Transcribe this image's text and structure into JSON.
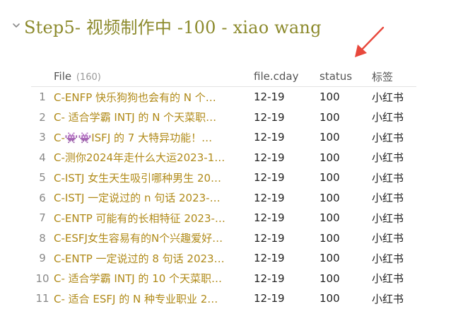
{
  "heading": {
    "title": "Step5- 视频制作中 -100 - xiao wang"
  },
  "table": {
    "columns": {
      "file": "File",
      "file_count": "(160)",
      "day": "file.cday",
      "status": "status",
      "tag": "标签"
    },
    "rows": [
      {
        "num": "1",
        "file": "C-ENFP 快乐狗狗也会有的 N 个…",
        "day": "12-19",
        "status": "100",
        "tag": "小红书"
      },
      {
        "num": "2",
        "file": "C- 适合学霸 INTJ 的 N 个天菜职…",
        "day": "12-19",
        "status": "100",
        "tag": "小红书"
      },
      {
        "num": "3",
        "file": "C-👾👾ISFJ 的 7 大特异功能！…",
        "day": "12-19",
        "status": "100",
        "tag": "小红书"
      },
      {
        "num": "4",
        "file": "C-测你2024年走什么大运2023-1…",
        "day": "12-19",
        "status": "100",
        "tag": "小红书"
      },
      {
        "num": "5",
        "file": "C-ISTJ 女生天生吸引哪种男生 20…",
        "day": "12-19",
        "status": "100",
        "tag": "小红书"
      },
      {
        "num": "6",
        "file": "C-ISTJ 一定说过的 n 句话 2023-…",
        "day": "12-19",
        "status": "100",
        "tag": "小红书"
      },
      {
        "num": "7",
        "file": "C-ENTP 可能有的长相特征 2023-…",
        "day": "12-19",
        "status": "100",
        "tag": "小红书"
      },
      {
        "num": "8",
        "file": "C-ESFJ女生容易有的N个兴趣爱好…",
        "day": "12-19",
        "status": "100",
        "tag": "小红书"
      },
      {
        "num": "9",
        "file": "C-ENTP 一定说过的 8 句话 2023…",
        "day": "12-19",
        "status": "100",
        "tag": "小红书"
      },
      {
        "num": "10",
        "file": "C- 适合学霸 INTJ 的 10 个天菜职…",
        "day": "12-19",
        "status": "100",
        "tag": "小红书"
      },
      {
        "num": "11",
        "file": "C- 适合 ESFJ 的 N 种专业职业 2…",
        "day": "12-19",
        "status": "100",
        "tag": "小红书"
      }
    ]
  },
  "colors": {
    "heading": "#8c8a2c",
    "link": "#b08a18",
    "arrow": "#e8483c"
  },
  "icons": {
    "fold": "chevron-down-icon",
    "annotation": "red-arrow-icon"
  }
}
